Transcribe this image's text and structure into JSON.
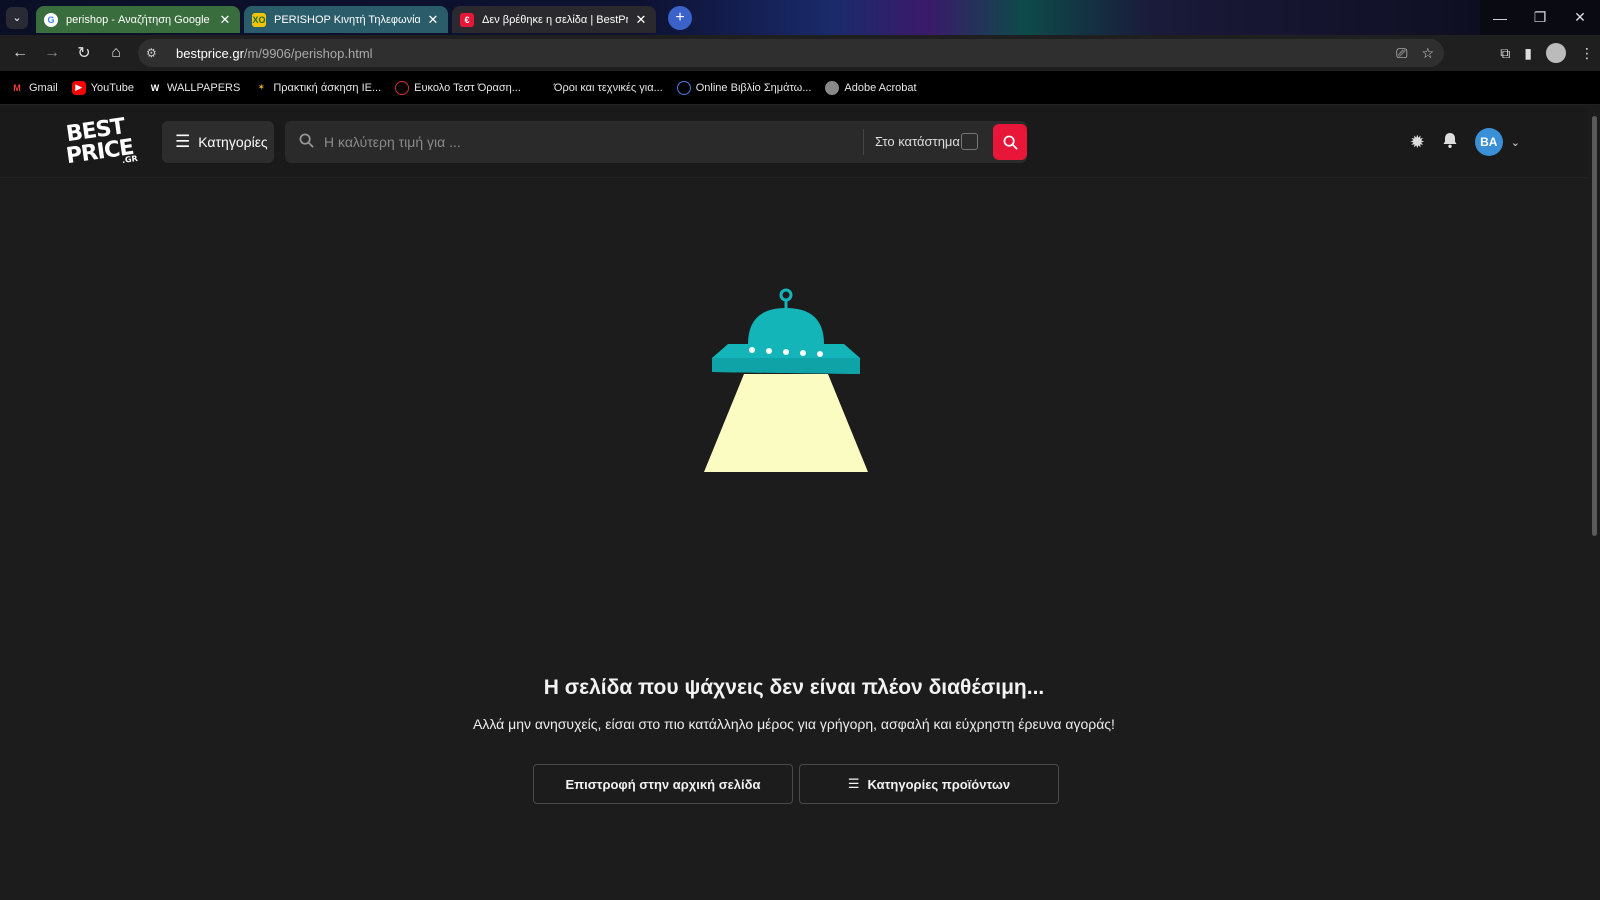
{
  "browser": {
    "tabs": [
      {
        "title": "perishop - Αναζήτηση Google",
        "favicon": "G"
      },
      {
        "title": "PERISHOP Κινητή Τηλεφωνία | Αξ",
        "favicon": "XO"
      },
      {
        "title": "Δεν βρέθηκε η σελίδα | BestPrice.gr",
        "favicon": "€"
      }
    ],
    "url_host": "bestprice.gr",
    "url_path": "/m/9906/perishop.html",
    "bookmarks": [
      {
        "label": "Gmail",
        "icon": "gmail-icon"
      },
      {
        "label": "YouTube",
        "icon": "youtube-icon"
      },
      {
        "label": "WALLPAPERS",
        "icon": "wallpapers-icon"
      },
      {
        "label": "Πρακτική άσκηση ΙΕ...",
        "icon": "bookmark-icon"
      },
      {
        "label": "Ευκολο Τεστ Όραση...",
        "icon": "eye-test-icon"
      },
      {
        "label": "Όροι και τεχνικές για...",
        "icon": "blank-icon"
      },
      {
        "label": "Online Βιβλίο Σημάτω...",
        "icon": "globe-icon"
      },
      {
        "label": "Adobe Acrobat",
        "icon": "acrobat-icon"
      }
    ]
  },
  "header": {
    "logo_line1": "BEST",
    "logo_line2": "PRICE",
    "logo_suffix": ".GR",
    "categories_label": "Κατηγορίες",
    "search_placeholder": "Η καλύτερη τιμή για ...",
    "store_label": "Στο κατάστημα",
    "avatar_initials": "BA",
    "accent_color": "#e8173a"
  },
  "main": {
    "headline": "Η σελίδα που ψάχνεις δεν είναι πλέον διαθέσιμη...",
    "subline": "Αλλά μην ανησυχείς, είσαι στο πιο κατάλληλο μέρος για γρήγορη, ασφαλή και εύχρηστη έρευνα αγοράς!",
    "home_button": "Επιστροφή στην αρχική σελίδα",
    "categories_button": "Κατηγορίες προϊόντων"
  }
}
